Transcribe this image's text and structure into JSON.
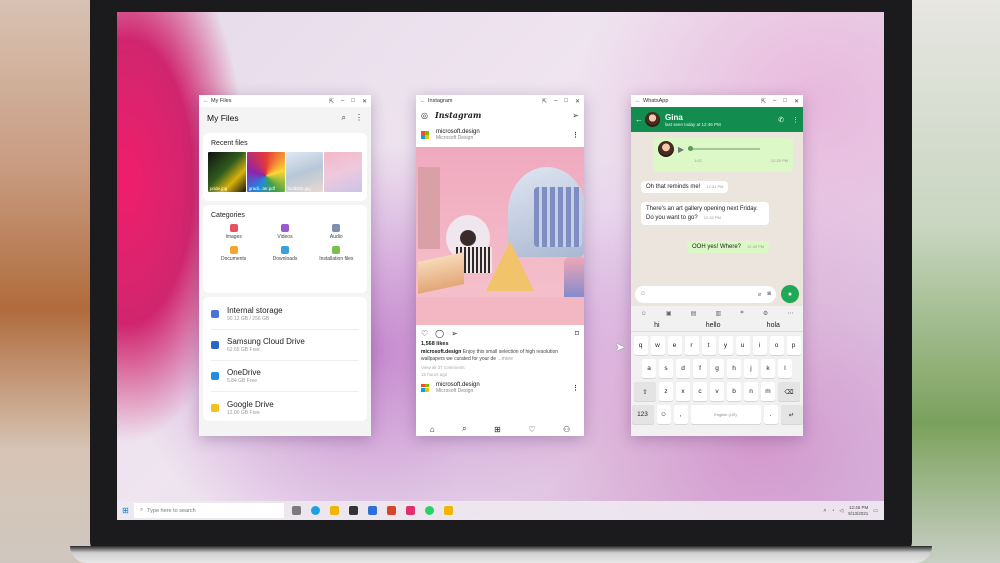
{
  "files": {
    "window_title": "My Files",
    "header_title": "My Files",
    "recent_label": "Recent files",
    "recent": [
      "pride.jpg",
      "gradi...ter.pdf",
      "footbtch.jpg",
      ""
    ],
    "categories_label": "Categories",
    "categories": [
      {
        "label": "Images",
        "color": "#e8505b"
      },
      {
        "label": "Videos",
        "color": "#9b59d0"
      },
      {
        "label": "Audio",
        "color": "#7d8fb3"
      },
      {
        "label": "Documents",
        "color": "#f0a830"
      },
      {
        "label": "Downloads",
        "color": "#3aa0e0"
      },
      {
        "label": "Installation files",
        "color": "#7cc04a"
      }
    ],
    "storage": [
      {
        "name": "Internal storage",
        "sub": "90.12 GB / 256 GB",
        "color": "#4a74d8"
      },
      {
        "name": "Samsung Cloud Drive",
        "sub": "62.65 GB Free",
        "color": "#2a66c9"
      },
      {
        "name": "OneDrive",
        "sub": "5.84 GB Free",
        "color": "#1d8fe0"
      },
      {
        "name": "Google Drive",
        "sub": "12.00 GB Free",
        "color": "#f2c21b"
      }
    ]
  },
  "insta": {
    "window_title": "Instagram",
    "logo": "Instagram",
    "account": "microsoft.design",
    "account_sub": "Microsoft Design",
    "likes": "1,568 likes",
    "caption_user": "microsoft.design",
    "caption_text": "Enjoy this small selection of high resolution wallpapers we curated for your de",
    "caption_more": "...more",
    "view_comments": "View all 37 comments",
    "time_ago": "15 hours ago",
    "next_account": "microsoft.design",
    "next_account_sub": "Microsoft Design"
  },
  "wa": {
    "window_title": "WhatsApp",
    "contact": "Gina",
    "status": "last seen today at 12:46 PM",
    "voice_duration": "1:02",
    "voice_time": "12:25 PM",
    "messages": [
      {
        "text": "Oh that reminds me!",
        "time": "12:31 PM",
        "dir": "in"
      },
      {
        "text": "There's an art gallery opening next Friday. Do you want to go?",
        "time": "12:32 PM",
        "dir": "in"
      },
      {
        "text": "OOH yes! Where?",
        "time": "12:40 PM",
        "dir": "out"
      }
    ],
    "suggestions": [
      "hi",
      "hello",
      "hola"
    ],
    "keyboard": {
      "row1": [
        "q",
        "w",
        "e",
        "r",
        "t",
        "y",
        "u",
        "i",
        "o",
        "p"
      ],
      "row2": [
        "a",
        "s",
        "d",
        "f",
        "g",
        "h",
        "j",
        "k",
        "l"
      ],
      "row3": [
        "z",
        "x",
        "c",
        "v",
        "b",
        "n",
        "m"
      ],
      "num_key": "123",
      "space_label": "English (US)"
    }
  },
  "taskbar": {
    "search_placeholder": "Type here to search",
    "time": "12:46 PM",
    "date": "5/13/2021",
    "apps": [
      "#7a7a7a",
      "#1aa0e0",
      "#f2b600",
      "#333333",
      "#2f6fd8",
      "#d6452a",
      "#e1306c",
      "#25d366",
      "#f2b600"
    ]
  }
}
